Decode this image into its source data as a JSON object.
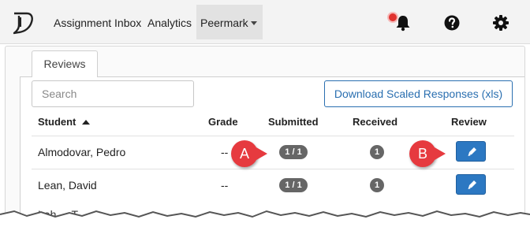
{
  "nav": {
    "items": [
      "Assignment Inbox",
      "Analytics",
      "Peermark"
    ],
    "logo_icon": "turnitin-logo-icon",
    "notification_icon": "bell-icon",
    "help_icon": "question-circle-icon",
    "settings_icon": "gear-icon"
  },
  "tabs": [
    "Reviews"
  ],
  "search": {
    "placeholder": "Search"
  },
  "download_label": "Download Scaled Responses (xls)",
  "table": {
    "headers": {
      "student": "Student",
      "grade": "Grade",
      "submitted": "Submitted",
      "received": "Received",
      "review": "Review"
    },
    "rows": [
      {
        "student": "Almodovar, Pedro",
        "grade": "--",
        "submitted": "1 / 1",
        "received": "1"
      },
      {
        "student": "Lean, David",
        "grade": "--",
        "submitted": "1 / 1",
        "received": "1"
      },
      {
        "student": "Leh..., T..."
      }
    ]
  },
  "callouts": [
    "A",
    "B"
  ],
  "colors": {
    "accent": "#2c78c2",
    "callout": "#e63a3f",
    "badge": "#666666",
    "notification_dot": "#e0322f"
  }
}
